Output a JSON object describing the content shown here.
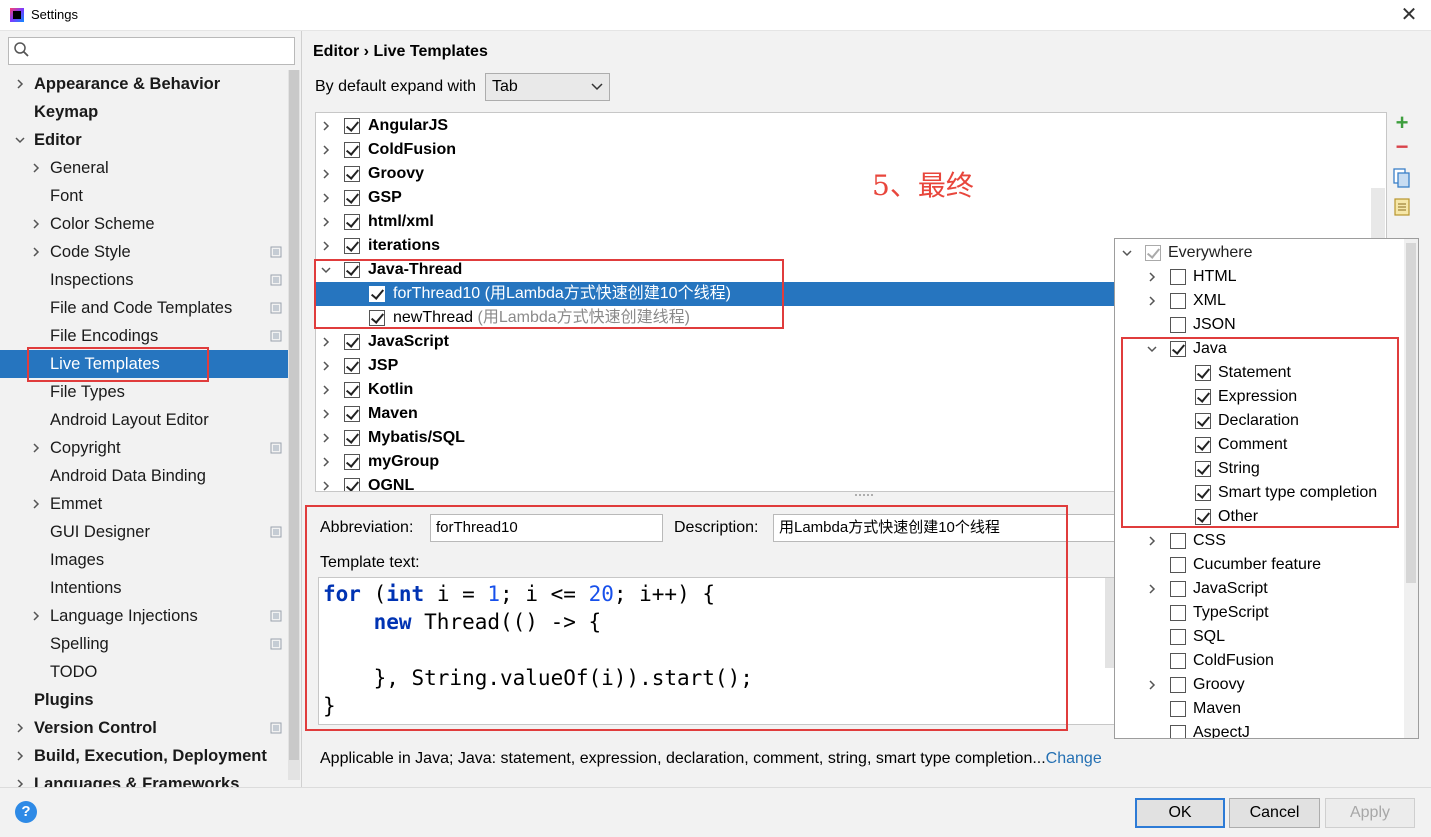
{
  "window": {
    "title": "Settings",
    "close_glyph": "✕"
  },
  "search": {
    "placeholder": ""
  },
  "sidebar": {
    "items": [
      {
        "label": "Appearance & Behavior",
        "arrow": "right",
        "bold": true,
        "project": false,
        "level": 0
      },
      {
        "label": "Keymap",
        "arrow": "none",
        "bold": true,
        "project": false,
        "level": 0
      },
      {
        "label": "Editor",
        "arrow": "down",
        "bold": true,
        "project": false,
        "level": 0
      },
      {
        "label": "General",
        "arrow": "right",
        "bold": false,
        "project": false,
        "level": 1
      },
      {
        "label": "Font",
        "arrow": "none",
        "bold": false,
        "project": false,
        "level": 1
      },
      {
        "label": "Color Scheme",
        "arrow": "right",
        "bold": false,
        "project": false,
        "level": 1
      },
      {
        "label": "Code Style",
        "arrow": "right",
        "bold": false,
        "project": true,
        "level": 1
      },
      {
        "label": "Inspections",
        "arrow": "none",
        "bold": false,
        "project": true,
        "level": 1
      },
      {
        "label": "File and Code Templates",
        "arrow": "none",
        "bold": false,
        "project": true,
        "level": 1
      },
      {
        "label": "File Encodings",
        "arrow": "none",
        "bold": false,
        "project": true,
        "level": 1
      },
      {
        "label": "Live Templates",
        "arrow": "none",
        "bold": false,
        "project": false,
        "level": 1,
        "selected": true
      },
      {
        "label": "File Types",
        "arrow": "none",
        "bold": false,
        "project": false,
        "level": 1
      },
      {
        "label": "Android Layout Editor",
        "arrow": "none",
        "bold": false,
        "project": false,
        "level": 1
      },
      {
        "label": "Copyright",
        "arrow": "right",
        "bold": false,
        "project": true,
        "level": 1
      },
      {
        "label": "Android Data Binding",
        "arrow": "none",
        "bold": false,
        "project": false,
        "level": 1
      },
      {
        "label": "Emmet",
        "arrow": "right",
        "bold": false,
        "project": false,
        "level": 1
      },
      {
        "label": "GUI Designer",
        "arrow": "none",
        "bold": false,
        "project": true,
        "level": 1
      },
      {
        "label": "Images",
        "arrow": "none",
        "bold": false,
        "project": false,
        "level": 1
      },
      {
        "label": "Intentions",
        "arrow": "none",
        "bold": false,
        "project": false,
        "level": 1
      },
      {
        "label": "Language Injections",
        "arrow": "right",
        "bold": false,
        "project": true,
        "level": 1
      },
      {
        "label": "Spelling",
        "arrow": "none",
        "bold": false,
        "project": true,
        "level": 1
      },
      {
        "label": "TODO",
        "arrow": "none",
        "bold": false,
        "project": false,
        "level": 1
      },
      {
        "label": "Plugins",
        "arrow": "none",
        "bold": true,
        "project": false,
        "level": 0
      },
      {
        "label": "Version Control",
        "arrow": "right",
        "bold": true,
        "project": true,
        "level": 0
      },
      {
        "label": "Build, Execution, Deployment",
        "arrow": "right",
        "bold": true,
        "project": false,
        "level": 0
      },
      {
        "label": "Languages & Frameworks",
        "arrow": "right",
        "bold": true,
        "project": false,
        "level": 0
      }
    ]
  },
  "main": {
    "breadcrumb": "Editor › Live Templates",
    "expand_label": "By default expand with",
    "expand_value": "Tab",
    "annotation": "5、最终",
    "templates": [
      {
        "name": "AngularJS",
        "expanded": false,
        "checked": true,
        "group": true
      },
      {
        "name": "ColdFusion",
        "expanded": false,
        "checked": true,
        "group": true
      },
      {
        "name": "Groovy",
        "expanded": false,
        "checked": true,
        "group": true
      },
      {
        "name": "GSP",
        "expanded": false,
        "checked": true,
        "group": true
      },
      {
        "name": "html/xml",
        "expanded": false,
        "checked": true,
        "group": true
      },
      {
        "name": "iterations",
        "expanded": false,
        "checked": true,
        "group": true
      },
      {
        "name": "Java-Thread",
        "expanded": true,
        "checked": true,
        "group": true
      },
      {
        "name": "forThread10",
        "desc": "(用Lambda方式快速创建10个线程)",
        "checked": true,
        "group": false,
        "selected": true
      },
      {
        "name": "newThread",
        "desc": "(用Lambda方式快速创建线程)",
        "checked": true,
        "group": false
      },
      {
        "name": "JavaScript",
        "expanded": false,
        "checked": true,
        "group": true
      },
      {
        "name": "JSP",
        "expanded": false,
        "checked": true,
        "group": true
      },
      {
        "name": "Kotlin",
        "expanded": false,
        "checked": true,
        "group": true
      },
      {
        "name": "Maven",
        "expanded": false,
        "checked": true,
        "group": true
      },
      {
        "name": "Mybatis/SQL",
        "expanded": false,
        "checked": true,
        "group": true
      },
      {
        "name": "myGroup",
        "expanded": false,
        "checked": true,
        "group": true
      },
      {
        "name": "OGNL",
        "expanded": false,
        "checked": true,
        "group": true
      }
    ],
    "tools": {
      "add": "+",
      "remove": "−"
    },
    "abbreviation_label": "Abbreviation:",
    "abbreviation_value": "forThread10",
    "description_label": "Description:",
    "description_value": "用Lambda方式快速创建10个线程",
    "template_text_label": "Template text:",
    "code_lines": [
      [
        {
          "t": "for",
          "c": "kw"
        },
        {
          "t": " (",
          "c": ""
        },
        {
          "t": "int",
          "c": "kw"
        },
        {
          "t": " i = ",
          "c": ""
        },
        {
          "t": "1",
          "c": "num"
        },
        {
          "t": "; i <= ",
          "c": ""
        },
        {
          "t": "20",
          "c": "num"
        },
        {
          "t": "; i++) {",
          "c": ""
        }
      ],
      [
        {
          "t": "    ",
          "c": ""
        },
        {
          "t": "new",
          "c": "kw"
        },
        {
          "t": " Thread(() -> {",
          "c": ""
        }
      ],
      [
        {
          "t": "",
          "c": ""
        }
      ],
      [
        {
          "t": "    }, String.valueOf(i)).start();",
          "c": ""
        }
      ],
      [
        {
          "t": "}",
          "c": ""
        }
      ]
    ],
    "applicable_text": "Applicable in Java; Java: statement, expression, declaration, comment, string, smart type completion...",
    "change_link": "Change"
  },
  "context_popup": {
    "items": [
      {
        "label": "Everywhere",
        "arrow": "down",
        "checked": true,
        "dim": true,
        "level": 0
      },
      {
        "label": "HTML",
        "arrow": "right",
        "checked": false,
        "level": 1
      },
      {
        "label": "XML",
        "arrow": "right",
        "checked": false,
        "level": 1
      },
      {
        "label": "JSON",
        "arrow": "none",
        "checked": false,
        "level": 1
      },
      {
        "label": "Java",
        "arrow": "down",
        "checked": true,
        "level": 1
      },
      {
        "label": "Statement",
        "arrow": "none",
        "checked": true,
        "level": 2
      },
      {
        "label": "Expression",
        "arrow": "none",
        "checked": true,
        "level": 2
      },
      {
        "label": "Declaration",
        "arrow": "none",
        "checked": true,
        "level": 2
      },
      {
        "label": "Comment",
        "arrow": "none",
        "checked": true,
        "level": 2
      },
      {
        "label": "String",
        "arrow": "none",
        "checked": true,
        "level": 2
      },
      {
        "label": "Smart type completion",
        "arrow": "none",
        "checked": true,
        "level": 2
      },
      {
        "label": "Other",
        "arrow": "none",
        "checked": true,
        "level": 2
      },
      {
        "label": "CSS",
        "arrow": "right",
        "checked": false,
        "level": 1
      },
      {
        "label": "Cucumber feature",
        "arrow": "none",
        "checked": false,
        "level": 1
      },
      {
        "label": "JavaScript",
        "arrow": "right",
        "checked": false,
        "level": 1
      },
      {
        "label": "TypeScript",
        "arrow": "none",
        "checked": false,
        "level": 1
      },
      {
        "label": "SQL",
        "arrow": "none",
        "checked": false,
        "level": 1
      },
      {
        "label": "ColdFusion",
        "arrow": "none",
        "checked": false,
        "level": 1
      },
      {
        "label": "Groovy",
        "arrow": "right",
        "checked": false,
        "level": 1
      },
      {
        "label": "Maven",
        "arrow": "none",
        "checked": false,
        "level": 1
      },
      {
        "label": "AspectJ",
        "arrow": "none",
        "checked": false,
        "level": 1
      }
    ]
  },
  "buttons": {
    "help": "?",
    "ok": "OK",
    "cancel": "Cancel",
    "apply": "Apply"
  },
  "colors": {
    "selection": "#2675bf",
    "annotation_red": "#e03c3c",
    "add_green": "#3d9e3d",
    "remove_red": "#d9434b",
    "link": "#2470b3"
  }
}
